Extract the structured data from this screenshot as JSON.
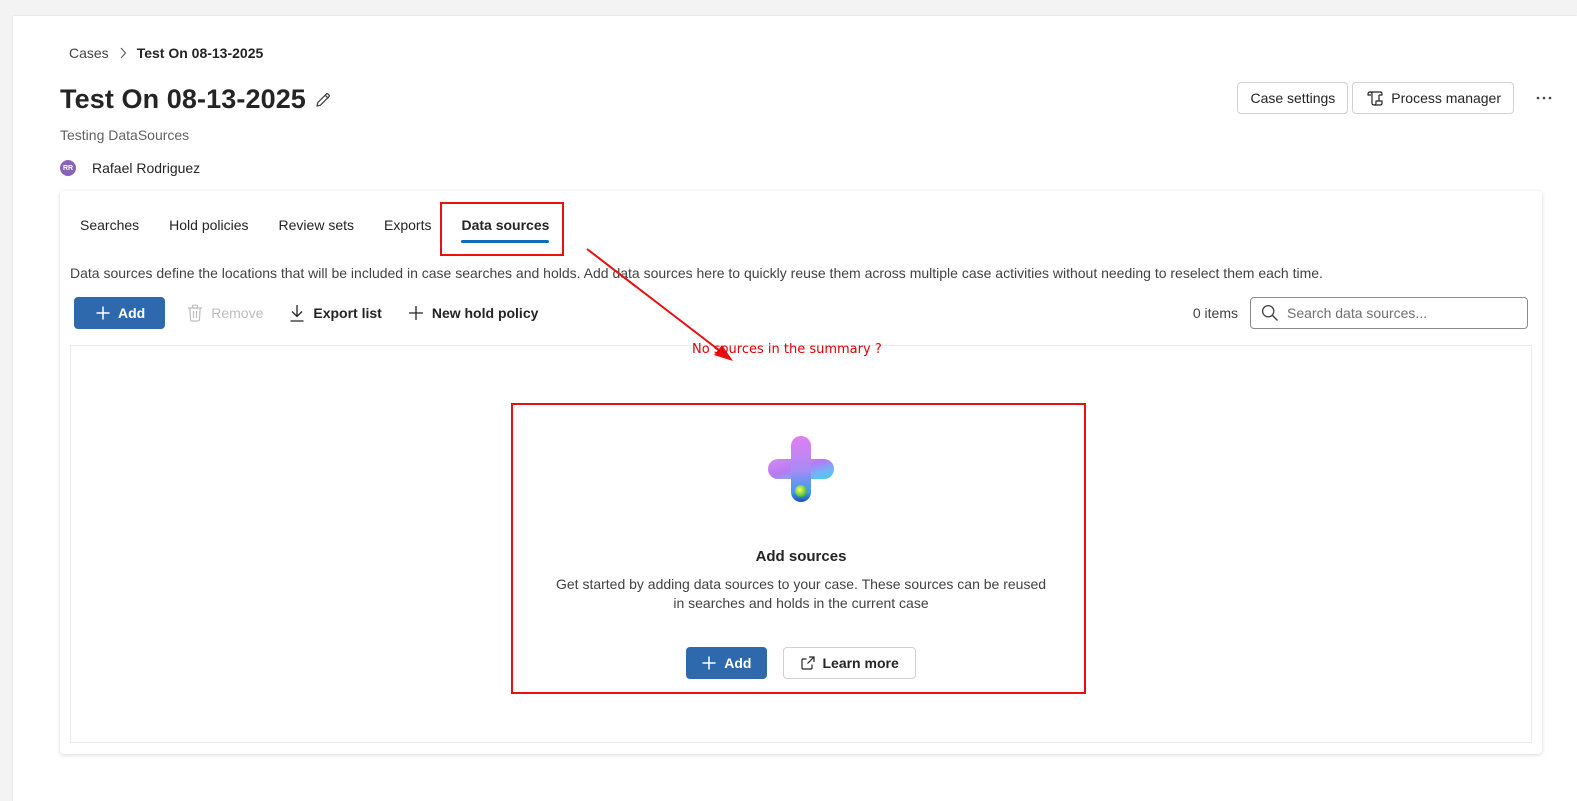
{
  "breadcrumb": {
    "root": "Cases",
    "current": "Test On 08-13-2025"
  },
  "case": {
    "title": "Test On 08-13-2025",
    "description": "Testing DataSources",
    "owner_initials": "RR",
    "owner_name": "Rafael Rodriguez"
  },
  "header_actions": {
    "case_settings": "Case settings",
    "process_manager": "Process manager"
  },
  "tabs": [
    {
      "label": "Searches"
    },
    {
      "label": "Hold policies"
    },
    {
      "label": "Review sets"
    },
    {
      "label": "Exports"
    },
    {
      "label": "Data sources",
      "active": true
    }
  ],
  "description": "Data sources define the locations that will be included in case searches and holds. Add data sources here to quickly reuse them across multiple case activities without needing to reselect them each time.",
  "toolbar": {
    "add": "Add",
    "remove": "Remove",
    "export": "Export list",
    "new_hold": "New hold policy",
    "count": "0 items",
    "search_placeholder": "Search data sources..."
  },
  "empty_state": {
    "title": "Add sources",
    "description": "Get started by adding data sources to your case. These sources can be reused in searches and holds in the current case",
    "add": "Add",
    "learn_more": "Learn more"
  },
  "annotation": {
    "note": "No sources in the summary ?",
    "color": "#e81010"
  },
  "colors": {
    "primary": "#2f69ad",
    "tab_underline": "#0f6cbd",
    "avatar": "#8764b8"
  }
}
